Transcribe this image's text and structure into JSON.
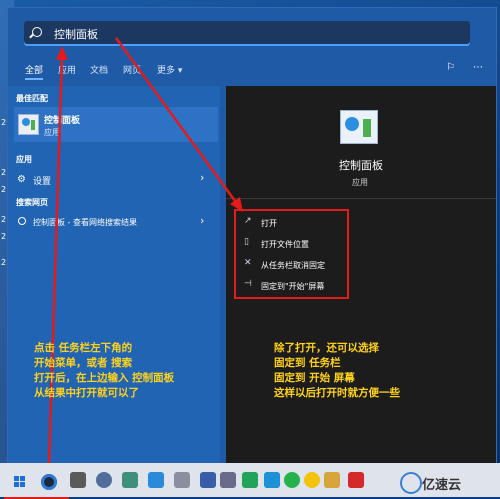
{
  "search": {
    "value": "控制面板"
  },
  "tabs": [
    "全部",
    "应用",
    "文档",
    "网页",
    "更多 ▾"
  ],
  "left_panel": {
    "best_match_title": "最佳匹配",
    "best_match_item": {
      "title": "控制面板",
      "subtitle": "应用"
    },
    "apps_title": "应用",
    "apps_item": "设置",
    "web_title": "搜索网页",
    "web_item": "控制面板 - 查看网络搜索结果"
  },
  "right_panel": {
    "title": "控制面板",
    "subtitle": "应用",
    "actions": [
      "打开",
      "打开文件位置",
      "从任务栏取消固定",
      "固定到\"开始\"屏幕"
    ]
  },
  "annotations": {
    "left_lines": [
      "点击 任务栏左下角的",
      "开始菜单，或者 搜索",
      "打开后，在上边输入 控制面板",
      "从结果中打开就可以了"
    ],
    "right_lines": [
      "除了打开，还可以选择",
      "固定到 任务栏",
      "固定到 开始 屏幕",
      "这样以后打开时就方便一些"
    ]
  },
  "watermark": "亿速云",
  "desktop_digits": [
    "2",
    "2",
    "2",
    "2",
    "2",
    "2"
  ],
  "colors": {
    "accent": "#4aa0ff",
    "annotation_red": "#e31b1b",
    "annotation_yellow": "#ffd21a"
  }
}
